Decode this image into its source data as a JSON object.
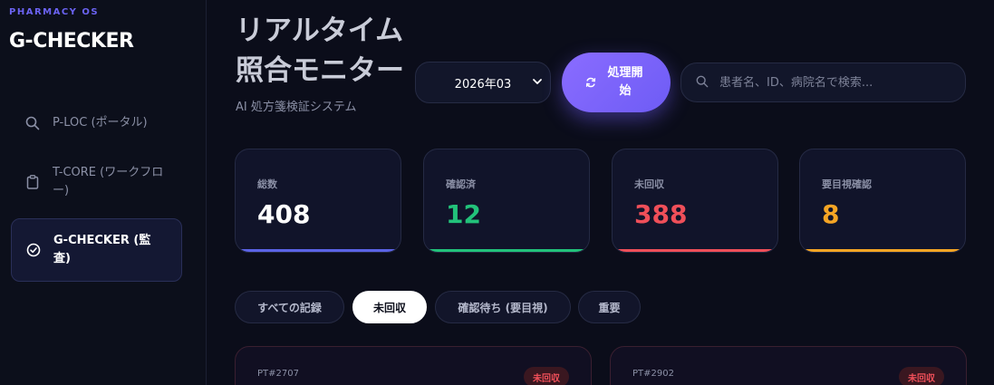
{
  "brand": {
    "kicker": "PHARMACY OS",
    "title": "G-CHECKER"
  },
  "sidebar": {
    "items": [
      {
        "label": "P-LOC (ポータル)",
        "icon": "search-icon"
      },
      {
        "label": "T-CORE (ワークフロー)",
        "icon": "clipboard-icon"
      },
      {
        "label": "G-CHECKER (監査)",
        "icon": "check-circle-icon",
        "active": true
      }
    ]
  },
  "header": {
    "title": "リアルタイム照合モニター",
    "subtitle": "AI 処方箋検証システム",
    "month": "2026年03",
    "process_label": "処理開始",
    "search_placeholder": "患者名、ID、病院名で検索..."
  },
  "stats": [
    {
      "label": "総数",
      "value": "408",
      "color": "#ffffff",
      "bar": "#5b63e6"
    },
    {
      "label": "確認済",
      "value": "12",
      "color": "#22c27a",
      "bar": "#22c27a"
    },
    {
      "label": "未回収",
      "value": "388",
      "color": "#ef4f59",
      "bar": "#ef4f59"
    },
    {
      "label": "要目視確認",
      "value": "8",
      "color": "#f5a524",
      "bar": "#f5a524"
    }
  ],
  "tabs": [
    {
      "label": "すべての記録"
    },
    {
      "label": "未回収",
      "active": true
    },
    {
      "label": "確認待ち (要目視)"
    },
    {
      "label": "重要"
    }
  ],
  "records": [
    {
      "id": "PT#2707",
      "status": "未回収"
    },
    {
      "id": "PT#2902",
      "status": "未回収"
    }
  ],
  "colors": {
    "accent": "#6e5cf5",
    "background": "#0b0d1a"
  }
}
